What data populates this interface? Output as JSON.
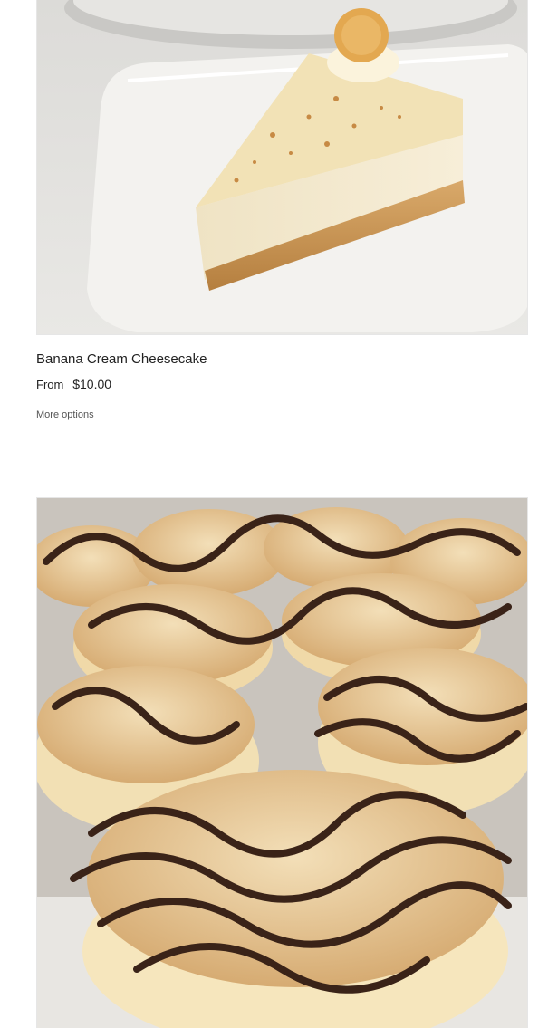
{
  "products": [
    {
      "title": "Banana Cream Cheesecake",
      "price_prefix": "From",
      "price": "$10.00",
      "more_options_label": "More options"
    }
  ],
  "colors": {
    "plate": "#ecebe8",
    "background": "#ffffff",
    "chocolate": "#3a2318",
    "cheesecake": "#f3e6c4"
  }
}
